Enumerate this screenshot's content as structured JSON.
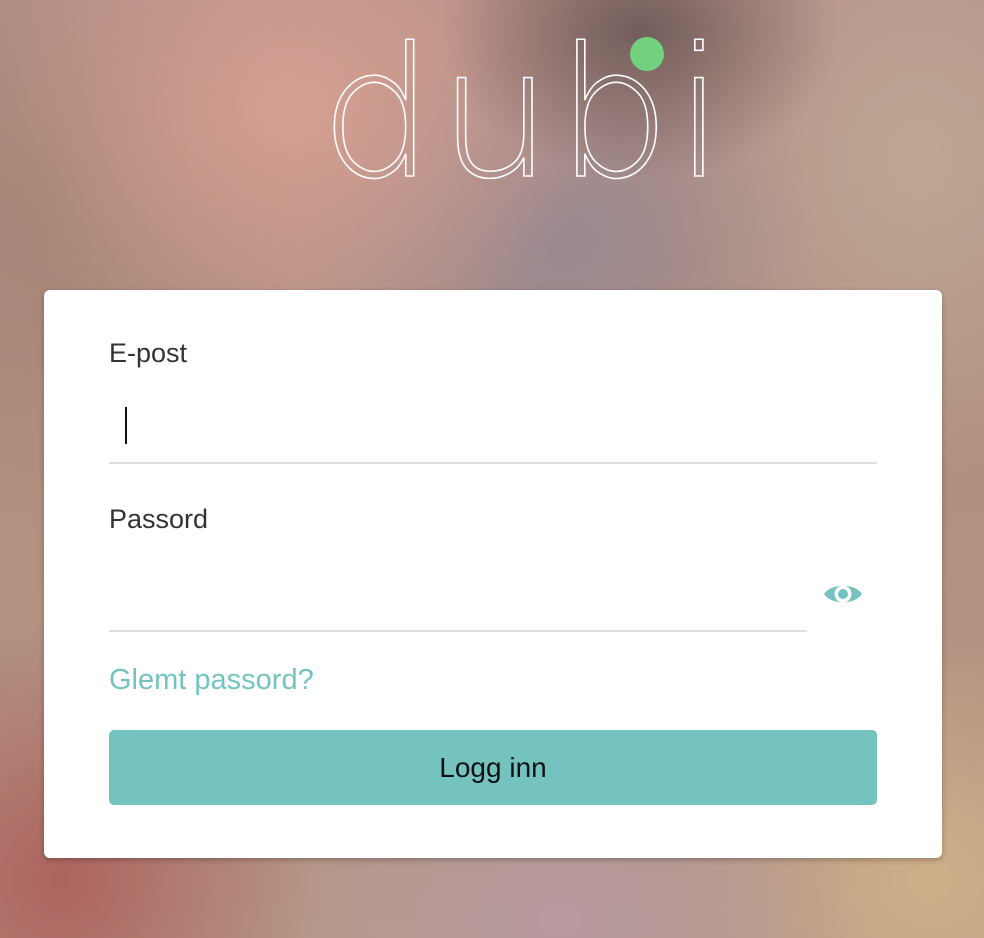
{
  "logo": {
    "text": "dubi",
    "dot_color": "#72d17f"
  },
  "form": {
    "email_label": "E-post",
    "email_value": "",
    "password_label": "Passord",
    "password_value": "",
    "show_password_icon": "eye-icon",
    "forgot_link": "Glemt passord?",
    "submit_label": "Logg inn"
  },
  "colors": {
    "accent": "#74c3bf",
    "card": "#ffffff",
    "text": "#333333"
  }
}
